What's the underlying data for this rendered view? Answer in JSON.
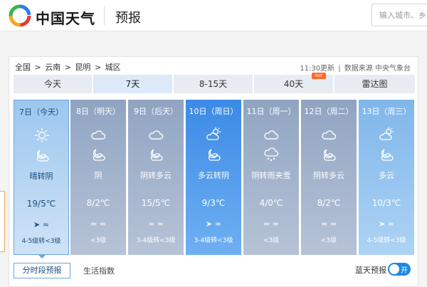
{
  "header": {
    "brand": "中国天气",
    "section_title": "预报",
    "search_placeholder": "输入城市、乡"
  },
  "breadcrumb": [
    "全国",
    ">",
    "云南",
    ">",
    "昆明",
    ">",
    "城区"
  ],
  "update": {
    "time": "11:30更新",
    "sep": "|",
    "source": "数据来源 中央气象台"
  },
  "tabs": [
    {
      "label": "今天"
    },
    {
      "label": "7天"
    },
    {
      "label": "8-15天"
    },
    {
      "label": "40天",
      "badge": "hot"
    },
    {
      "label": "雷达图"
    }
  ],
  "days": [
    {
      "date": "7日（今天）",
      "icon1": "sun-icon",
      "icon2": "cloudy-icon",
      "desc": "晴转阴",
      "temp": "19/5℃",
      "wind_dir": "➤  ≈",
      "wind": "4-5级转<3级"
    },
    {
      "date": "8日（明天）",
      "icon1": "cloud-icon",
      "icon2": "moon-cloud-icon",
      "desc": "阴",
      "temp": "8/2℃",
      "wind_dir": "≈  ≈",
      "wind": "<3级"
    },
    {
      "date": "9日（后天）",
      "icon1": "cloud-icon",
      "icon2": "moon-cloud-icon",
      "desc": "阴转多云",
      "temp": "15/5℃",
      "wind_dir": "≈  ≈",
      "wind": "3-4级转<3级"
    },
    {
      "date": "10日（周日）",
      "icon1": "sun-cloud-icon",
      "icon2": "moon-cloud-icon",
      "desc": "多云转阴",
      "temp": "9/3℃",
      "wind_dir": "➤  ≈",
      "wind": "3-4级转<3级"
    },
    {
      "date": "11日（周一）",
      "icon1": "cloud-icon",
      "icon2": "sleet-icon",
      "desc": "阴转雨夹雪",
      "temp": "4/0℃",
      "wind_dir": "≈  ≈",
      "wind": "<3级"
    },
    {
      "date": "12日（周二）",
      "icon1": "cloud-icon",
      "icon2": "moon-cloud-icon",
      "desc": "阴转多云",
      "temp": "8/2℃",
      "wind_dir": "≈  ≈",
      "wind": "<3级"
    },
    {
      "date": "13日（周三）",
      "icon1": "sun-cloud-icon",
      "icon2": "moon-cloud-icon",
      "desc": "多云",
      "temp": "10/3℃",
      "wind_dir": "➤  ≈",
      "wind": "4-5级转<3级"
    }
  ],
  "footer": {
    "hourly_btn": "分时段预报",
    "life_index": "生活指数",
    "bluesky": "蓝天预报",
    "toggle_label": "开"
  },
  "colors": {
    "accent": "#1e88e5",
    "hot_badge": "#ff6a2b",
    "today_border": "#6aa6e0"
  }
}
